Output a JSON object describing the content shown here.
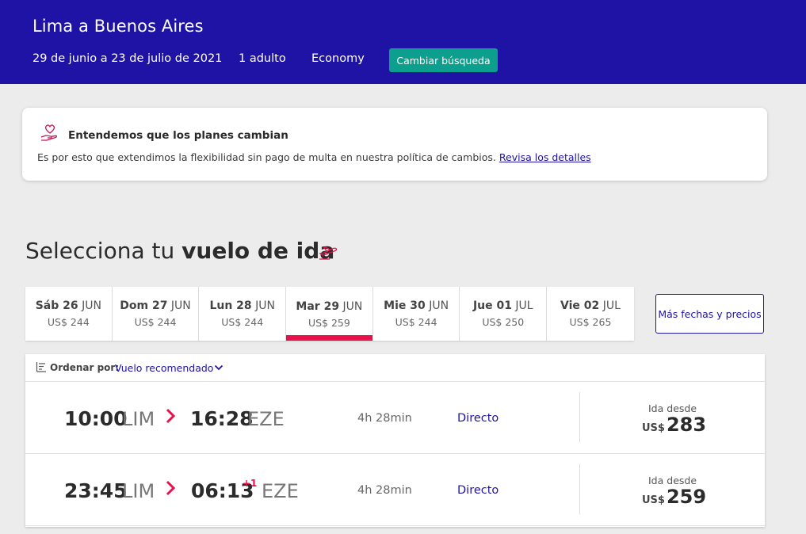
{
  "header": {
    "title": "Lima a Buenos Aires",
    "dates": "29 de junio a 23 de julio de 2021",
    "passengers": "1 adulto",
    "cabin": "Economy",
    "change_label": "Cambiar búsqueda"
  },
  "notice": {
    "icon": "hand-heart-icon",
    "title": "Entendemos que los planes cambian",
    "text": "Es por esto que extendimos la flexibilidad sin pago de multa en nuestra política de cambios.",
    "link": "Revisa los detalles"
  },
  "section": {
    "title_plain": "Selecciona tu ",
    "title_bold": "vuelo de ida",
    "icon": "plane-takeoff-icon"
  },
  "date_tabs": [
    {
      "day": "Sáb 26",
      "month": "JUN",
      "price": "US$ 244",
      "active": false
    },
    {
      "day": "Dom 27",
      "month": "JUN",
      "price": "US$ 244",
      "active": false
    },
    {
      "day": "Lun 28",
      "month": "JUN",
      "price": "US$ 244",
      "active": false
    },
    {
      "day": "Mar 29",
      "month": "JUN",
      "price": "US$ 259",
      "active": true
    },
    {
      "day": "Mie 30",
      "month": "JUN",
      "price": "US$ 244",
      "active": false
    },
    {
      "day": "Jue 01",
      "month": "JUL",
      "price": "US$ 250",
      "active": false
    },
    {
      "day": "Vie 02",
      "month": "JUL",
      "price": "US$ 265",
      "active": false
    }
  ],
  "more_dates_label": "Más fechas y precios",
  "sort": {
    "label": "Ordenar por:",
    "value": "Vuelo recomendado"
  },
  "flights": [
    {
      "depart_time": "10:00",
      "depart_airport": "LIM",
      "arrive_time": "16:28",
      "arrive_airport": "EZE",
      "day_offset": "",
      "duration": "4h 28min",
      "type": "Directo",
      "from_label": "Ida desde",
      "currency": "US$",
      "price": "283"
    },
    {
      "depart_time": "23:45",
      "depart_airport": "LIM",
      "arrive_time": "06:13",
      "arrive_airport": "EZE",
      "day_offset": "+1",
      "duration": "4h 28min",
      "type": "Directo",
      "from_label": "Ida desde",
      "currency": "US$",
      "price": "259"
    }
  ],
  "colors": {
    "brand": "#1f13a5",
    "accent": "#e8114b",
    "button": "#0d9f8d"
  }
}
